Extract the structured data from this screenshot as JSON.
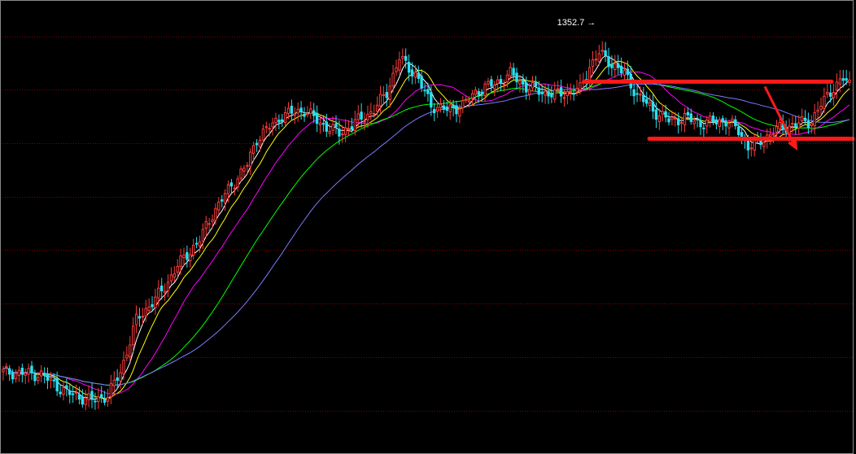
{
  "chart_data": {
    "type": "candlestick",
    "grid": true,
    "grid_style": "dotted",
    "background": "#000000",
    "colors": {
      "up": "#ff3b3b",
      "down": "#29e0f0",
      "grid": "#8a0000",
      "ma5": "#ffffff",
      "ma10": "#ffff00",
      "ma20": "#ff00ff",
      "ma40": "#00ff00",
      "ma60": "#7a7aff",
      "annotation": "#ff1a1a"
    },
    "y_range": [
      1195,
      1362
    ],
    "peak_label": "1352.7",
    "peak_arrow": "→",
    "keypoints": [
      [
        0,
        1221
      ],
      [
        12,
        1220
      ],
      [
        20,
        1213
      ],
      [
        28,
        1210
      ],
      [
        33,
        1212
      ],
      [
        37,
        1221
      ],
      [
        42,
        1241
      ],
      [
        50,
        1252
      ],
      [
        55,
        1262
      ],
      [
        62,
        1272
      ],
      [
        66,
        1282
      ],
      [
        72,
        1293
      ],
      [
        77,
        1301
      ],
      [
        80,
        1311
      ],
      [
        88,
        1320
      ],
      [
        95,
        1322
      ],
      [
        100,
        1317
      ],
      [
        106,
        1313
      ],
      [
        112,
        1318
      ],
      [
        117,
        1322
      ],
      [
        121,
        1329
      ],
      [
        125,
        1342
      ],
      [
        130,
        1336
      ],
      [
        135,
        1324
      ],
      [
        140,
        1322
      ],
      [
        145,
        1324
      ],
      [
        150,
        1330
      ],
      [
        155,
        1332
      ],
      [
        160,
        1336
      ],
      [
        165,
        1331
      ],
      [
        170,
        1329
      ],
      [
        175,
        1328
      ],
      [
        182,
        1330
      ],
      [
        185,
        1339
      ],
      [
        188,
        1344
      ],
      [
        192,
        1340
      ],
      [
        196,
        1336
      ],
      [
        200,
        1328
      ],
      [
        205,
        1322
      ],
      [
        210,
        1318
      ],
      [
        215,
        1319
      ],
      [
        220,
        1317
      ],
      [
        228,
        1318
      ],
      [
        232,
        1314
      ],
      [
        235,
        1308
      ],
      [
        238,
        1309
      ],
      [
        243,
        1314
      ],
      [
        248,
        1316
      ],
      [
        255,
        1318
      ],
      [
        258,
        1324
      ],
      [
        262,
        1331
      ],
      [
        265,
        1334
      ],
      [
        267,
        1332
      ]
    ],
    "moving_averages": [
      {
        "period": 5,
        "color": "#ffffff"
      },
      {
        "period": 10,
        "color": "#ffff00"
      },
      {
        "period": 20,
        "color": "#ff00ff"
      },
      {
        "period": 40,
        "color": "#00ff00"
      },
      {
        "period": 60,
        "color": "#7a7aff"
      }
    ],
    "annotations": {
      "resistance_level": 1333,
      "support_level": 1311,
      "forecast": "down"
    }
  }
}
